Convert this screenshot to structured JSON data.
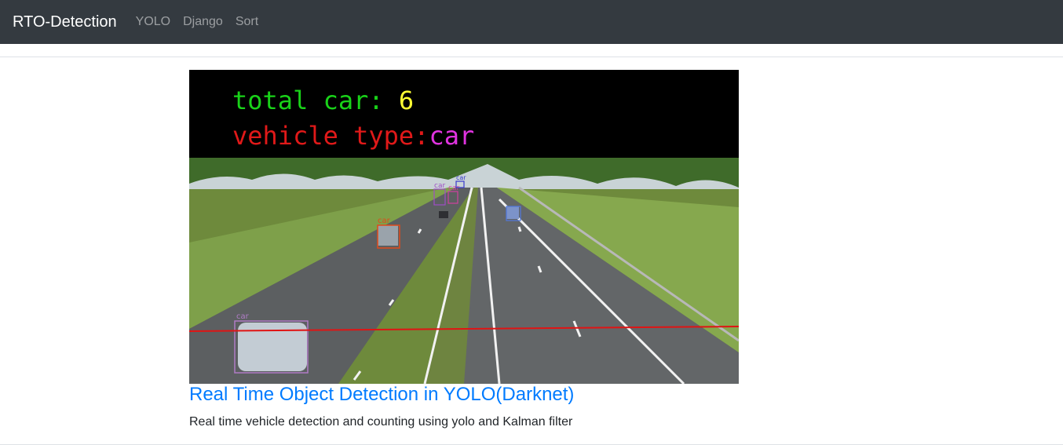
{
  "navbar": {
    "brand": "RTO-Detection",
    "links": [
      "YOLO",
      "Django",
      "Sort"
    ]
  },
  "video": {
    "overlay": {
      "total_label": "total car: ",
      "total_value": "6",
      "type_label": "vehicle type:",
      "type_value": "car"
    },
    "detection_label": "car",
    "colors": {
      "total_label": "#19d219",
      "total_value": "#ffff33",
      "type_label": "#e01919",
      "type_value": "#e033e0",
      "count_line": "#e01414"
    }
  },
  "card": {
    "title": "Real Time Object Detection in YOLO(Darknet)",
    "text": "Real time vehicle detection and counting using yolo and Kalman filter"
  }
}
